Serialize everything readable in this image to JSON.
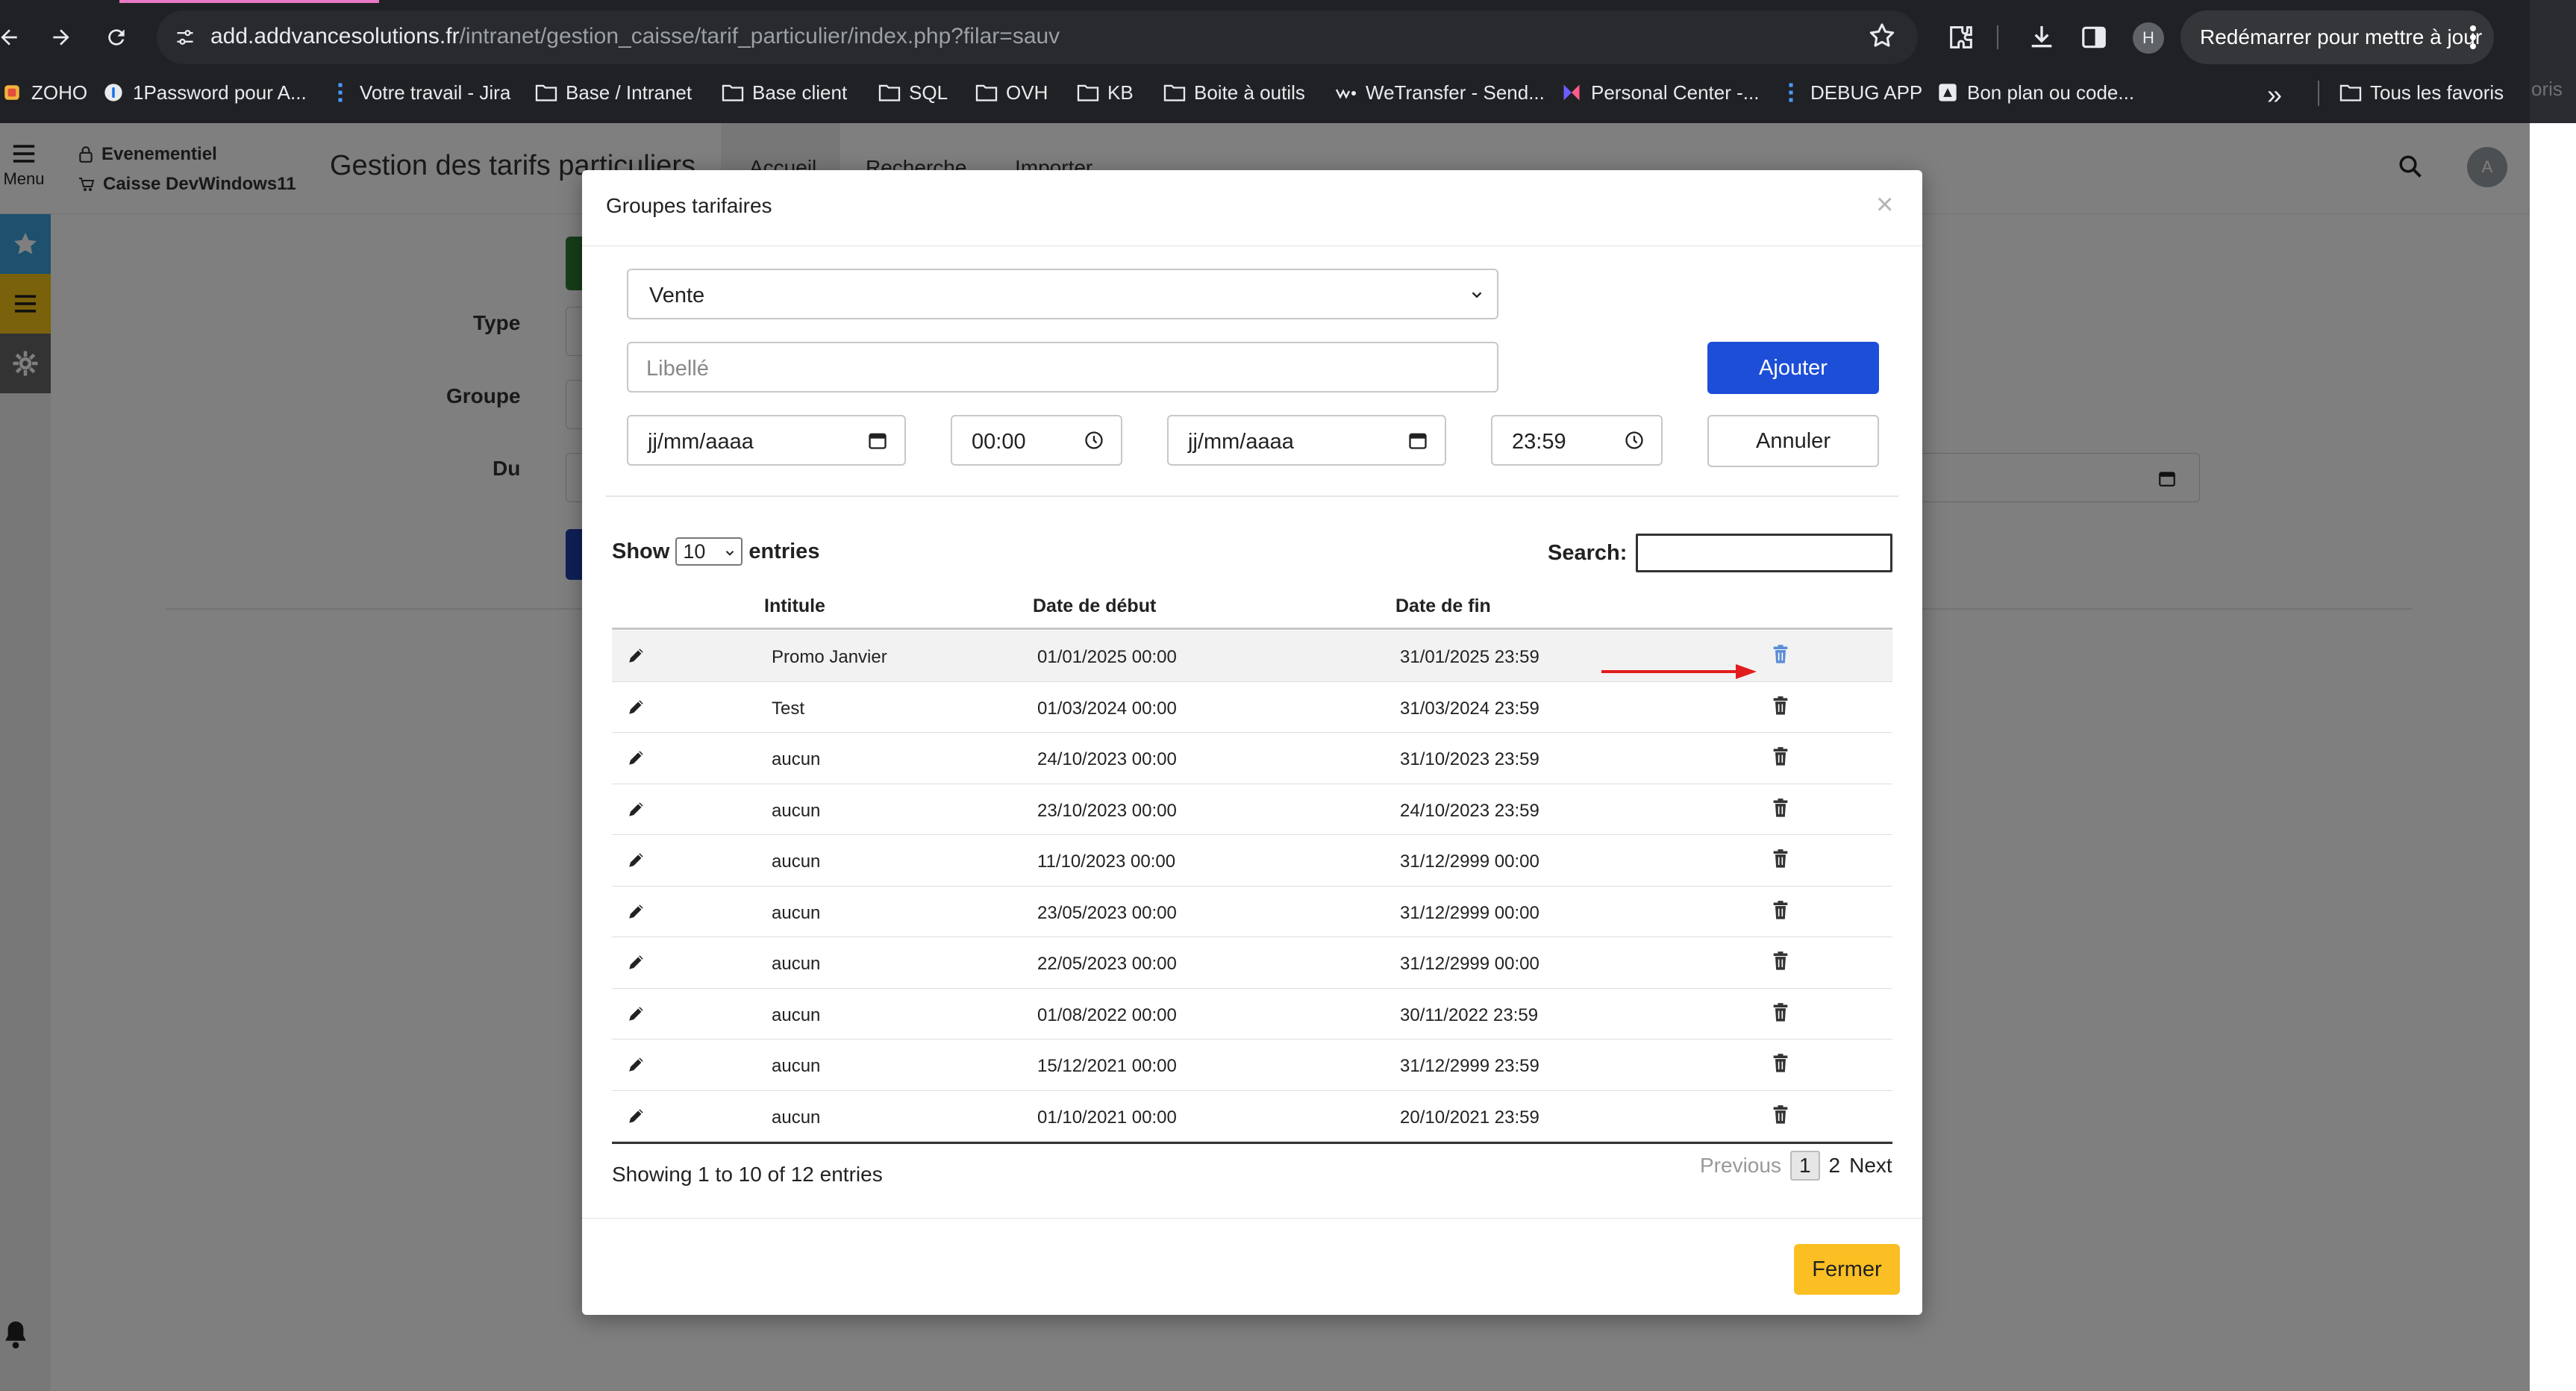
{
  "browser": {
    "url_host": "add.addvancesolutions.fr",
    "url_path": "/intranet/gestion_caisse/tarif_particulier/index.php?filar=sauv",
    "update_button": "Redémarrer pour mettre à jour",
    "profile_initial": "H",
    "side_window_text": "oris",
    "bookmarks": [
      {
        "label": "ZOHO",
        "icon": "zoho-logo-icon"
      },
      {
        "label": "1Password pour A...",
        "icon": "1password-icon"
      },
      {
        "label": "Votre travail - Jira",
        "icon": "jira-icon"
      },
      {
        "label": "Base / Intranet",
        "icon": "folder-icon"
      },
      {
        "label": "Base client",
        "icon": "folder-icon"
      },
      {
        "label": "SQL",
        "icon": "folder-icon"
      },
      {
        "label": "OVH",
        "icon": "folder-icon"
      },
      {
        "label": "KB",
        "icon": "folder-icon"
      },
      {
        "label": "Boite à outils",
        "icon": "folder-icon"
      },
      {
        "label": "WeTransfer - Send...",
        "icon": "wetransfer-icon"
      },
      {
        "label": "Personal Center -...",
        "icon": "personal-center-icon"
      },
      {
        "label": "DEBUG APP",
        "icon": "jira-icon"
      },
      {
        "label": "Bon plan ou code...",
        "icon": "bon-plan-icon"
      }
    ],
    "bookmarks_more": "»",
    "all_bookmarks": "Tous les favoris"
  },
  "app": {
    "menu_label": "Menu",
    "context_line1": "Evenementiel",
    "context_line2": "Caisse DevWindows11",
    "title": "Gestion des tarifs particuliers",
    "tabs": [
      "Accueil",
      "Recherche",
      "Importer"
    ],
    "avatar_initial": "A",
    "form_labels": {
      "type": "Type",
      "groupe": "Groupe",
      "du": "Du"
    }
  },
  "modal": {
    "title": "Groupes tarifaires",
    "close": "×",
    "type_select": "Vente",
    "libelle_placeholder": "Libellé",
    "date_start": "jj/mm/aaaa",
    "time_start": "00:00",
    "date_end": "jj/mm/aaaa",
    "time_end": "23:59",
    "add_button": "Ajouter",
    "cancel_button": "Annuler",
    "show_label": "Show",
    "page_length": "10",
    "entries_label": "entries",
    "search_label": "Search:",
    "search_value": "",
    "columns": [
      "Intitule",
      "Date de début",
      "Date de fin"
    ],
    "rows": [
      {
        "title": "Promo Janvier",
        "start": "01/01/2025 00:00",
        "end": "31/01/2025 23:59"
      },
      {
        "title": "Test",
        "start": "01/03/2024 00:00",
        "end": "31/03/2024 23:59"
      },
      {
        "title": "aucun",
        "start": "24/10/2023 00:00",
        "end": "31/10/2023 23:59"
      },
      {
        "title": "aucun",
        "start": "23/10/2023 00:00",
        "end": "24/10/2023 23:59"
      },
      {
        "title": "aucun",
        "start": "11/10/2023 00:00",
        "end": "31/12/2999 00:00"
      },
      {
        "title": "aucun",
        "start": "23/05/2023 00:00",
        "end": "31/12/2999 00:00"
      },
      {
        "title": "aucun",
        "start": "22/05/2023 00:00",
        "end": "31/12/2999 00:00"
      },
      {
        "title": "aucun",
        "start": "01/08/2022 00:00",
        "end": "30/11/2022 23:59"
      },
      {
        "title": "aucun",
        "start": "15/12/2021 00:00",
        "end": "31/12/2999 23:59"
      },
      {
        "title": "aucun",
        "start": "01/10/2021 00:00",
        "end": "20/10/2021 23:59"
      }
    ],
    "info": "Showing 1 to 10 of 12 entries",
    "pagination": {
      "previous": "Previous",
      "pages": [
        "1",
        "2"
      ],
      "current": "1",
      "next": "Next"
    },
    "close_button": "Fermer"
  },
  "colors": {
    "primary": "#1d4ed8",
    "warning": "#fbbf24",
    "annotation_arrow": "#e11d1d",
    "highlight_trash": "#5b8dd6"
  }
}
